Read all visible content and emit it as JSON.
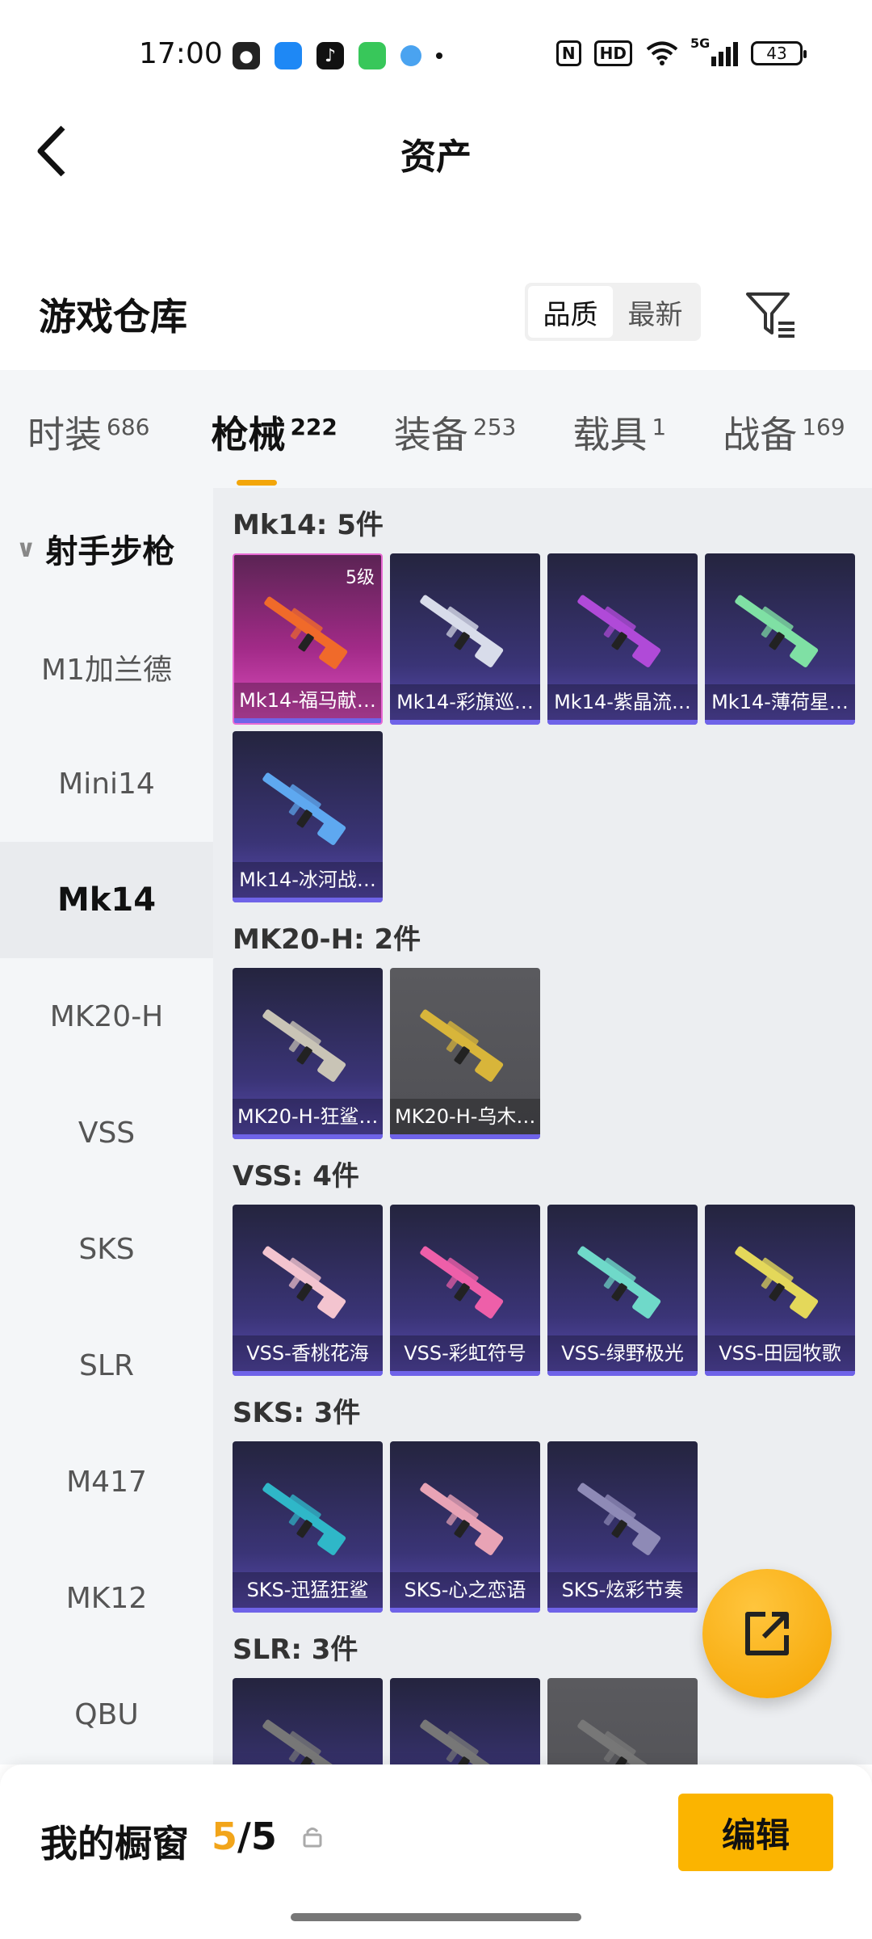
{
  "status": {
    "time": "17:00",
    "battery": "43",
    "hd": "HD",
    "net": "5G"
  },
  "header": {
    "title": "资产"
  },
  "section": {
    "title": "游戏仓库",
    "sort_options": [
      "品质",
      "最新"
    ],
    "active_sort": "品质"
  },
  "tabs": [
    {
      "label": "时装",
      "count": "686"
    },
    {
      "label": "枪械",
      "count": "222"
    },
    {
      "label": "装备",
      "count": "253"
    },
    {
      "label": "载具",
      "count": "1"
    },
    {
      "label": "战备",
      "count": "169"
    }
  ],
  "active_tab": "枪械",
  "sidebar": {
    "group": "射手步枪",
    "items": [
      "M1加兰德",
      "Mini14",
      "Mk14",
      "MK20-H",
      "VSS",
      "SKS",
      "SLR",
      "M417",
      "MK12",
      "QBU"
    ],
    "active": "Mk14"
  },
  "groups": [
    {
      "title": "Mk14: 5件",
      "items": [
        {
          "name": "Mk14-福马献…",
          "level": "5级",
          "style": "pink",
          "gun_color": "#f06a2a"
        },
        {
          "name": "Mk14-彩旗巡…",
          "style": "purple",
          "gun_color": "#d8dcea"
        },
        {
          "name": "Mk14-紫晶流…",
          "style": "purple",
          "gun_color": "#b04ad8"
        },
        {
          "name": "Mk14-薄荷星…",
          "style": "purple",
          "gun_color": "#7fe0a4"
        },
        {
          "name": "Mk14-冰河战…",
          "style": "purple",
          "gun_color": "#5ea8f0"
        }
      ]
    },
    {
      "title": "MK20-H: 2件",
      "items": [
        {
          "name": "MK20-H-狂鲨…",
          "style": "purple",
          "gun_color": "#c9c4b6"
        },
        {
          "name": "MK20-H-乌木…",
          "style": "gray",
          "gun_color": "#d8b53a"
        }
      ]
    },
    {
      "title": "VSS: 4件",
      "items": [
        {
          "name": "VSS-香桃花海",
          "style": "purple",
          "gun_color": "#f3c4cf"
        },
        {
          "name": "VSS-彩虹符号",
          "style": "purple",
          "gun_color": "#ee5fa9"
        },
        {
          "name": "VSS-绿野极光",
          "style": "purple",
          "gun_color": "#6fd9c9"
        },
        {
          "name": "VSS-田园牧歌",
          "style": "purple",
          "gun_color": "#e4d85a"
        }
      ]
    },
    {
      "title": "SKS: 3件",
      "items": [
        {
          "name": "SKS-迅猛狂鲨",
          "style": "purple",
          "gun_color": "#2fb7c8"
        },
        {
          "name": "SKS-心之恋语",
          "style": "purple",
          "gun_color": "#e8a3b5"
        },
        {
          "name": "SKS-炫彩节奏",
          "style": "purple",
          "gun_color": "#8e8ab6"
        }
      ]
    },
    {
      "title": "SLR: 3件",
      "items": [
        {
          "name": "",
          "style": "purple",
          "gun_color": "#777"
        },
        {
          "name": "",
          "style": "purple",
          "gun_color": "#777"
        },
        {
          "name": "",
          "style": "gray",
          "gun_color": "#777"
        }
      ]
    }
  ],
  "showcase": {
    "label": "我的橱窗",
    "current": "5",
    "total": "5",
    "edit_label": "编辑"
  },
  "colors": {
    "accent": "#f3a60a",
    "fab": "#f5a400",
    "edit_button": "#fbb400"
  }
}
